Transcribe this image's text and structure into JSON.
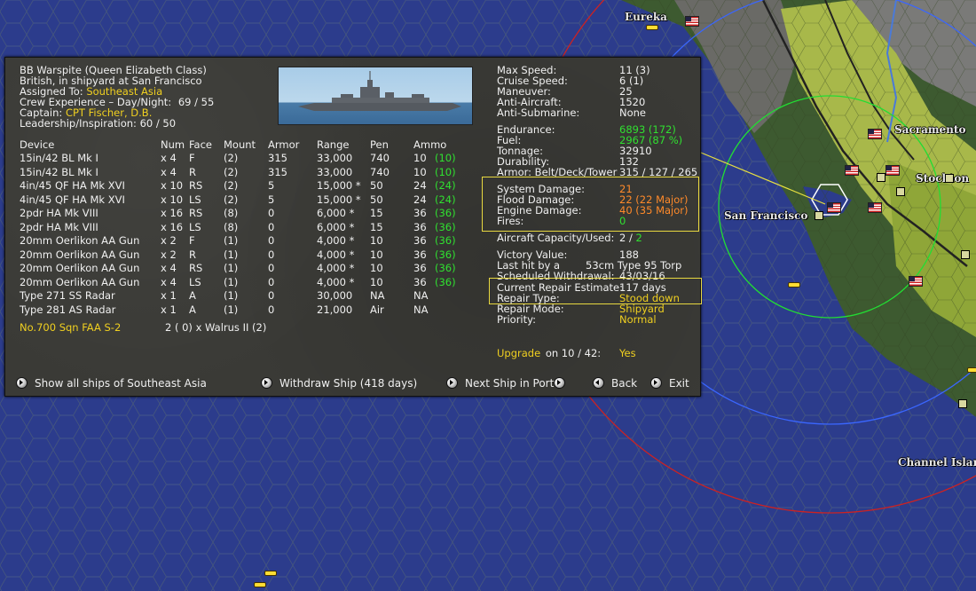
{
  "map": {
    "towns": [
      {
        "name": "Eureka"
      },
      {
        "name": "Sacramento"
      },
      {
        "name": "Stockton"
      },
      {
        "name": "San Francisco"
      },
      {
        "name": "Channel Islan"
      }
    ]
  },
  "ship": {
    "title": "BB Warspite (Queen Elizabeth Class)",
    "location": "British, in shipyard at San Francisco",
    "assigned_label": "Assigned To:",
    "assigned_value": "Southeast Asia",
    "crew_label": "Crew Experience – Day/Night:",
    "crew_value": "69 / 55",
    "captain_label": "Captain:",
    "captain_value": "CPT Fischer, D.B.",
    "leadership_label": "Leadership/Inspiration:",
    "leadership_value": "60 / 50"
  },
  "devices": {
    "headers": [
      "Device",
      "Num",
      "Face",
      "Mount",
      "Armor",
      "Range",
      "Pen",
      "Ammo"
    ],
    "rows": [
      {
        "device": "15in/42 BL Mk I",
        "num": "x 4",
        "face": "F",
        "mount": "(2)",
        "armor": "315",
        "range": "33,000",
        "pen": "740",
        "ammo": "10",
        "ammo2": "(10)"
      },
      {
        "device": "15in/42 BL Mk I",
        "num": "x 4",
        "face": "R",
        "mount": "(2)",
        "armor": "315",
        "range": "33,000",
        "pen": "740",
        "ammo": "10",
        "ammo2": "(10)"
      },
      {
        "device": "4in/45 QF HA Mk XVI",
        "num": "x 10",
        "face": "RS",
        "mount": "(2)",
        "armor": "5",
        "range": "15,000 *",
        "pen": "50",
        "ammo": "24",
        "ammo2": "(24)"
      },
      {
        "device": "4in/45 QF HA Mk XVI",
        "num": "x 10",
        "face": "LS",
        "mount": "(2)",
        "armor": "5",
        "range": "15,000 *",
        "pen": "50",
        "ammo": "24",
        "ammo2": "(24)"
      },
      {
        "device": "2pdr HA Mk VIII",
        "num": "x 16",
        "face": "RS",
        "mount": "(8)",
        "armor": "0",
        "range": "6,000 *",
        "pen": "15",
        "ammo": "36",
        "ammo2": "(36)"
      },
      {
        "device": "2pdr HA Mk VIII",
        "num": "x 16",
        "face": "LS",
        "mount": "(8)",
        "armor": "0",
        "range": "6,000 *",
        "pen": "15",
        "ammo": "36",
        "ammo2": "(36)"
      },
      {
        "device": "20mm Oerlikon AA Gun",
        "num": "x 2",
        "face": "F",
        "mount": "(1)",
        "armor": "0",
        "range": "4,000 *",
        "pen": "10",
        "ammo": "36",
        "ammo2": "(36)"
      },
      {
        "device": "20mm Oerlikon AA Gun",
        "num": "x 2",
        "face": "R",
        "mount": "(1)",
        "armor": "0",
        "range": "4,000 *",
        "pen": "10",
        "ammo": "36",
        "ammo2": "(36)"
      },
      {
        "device": "20mm Oerlikon AA Gun",
        "num": "x 4",
        "face": "RS",
        "mount": "(1)",
        "armor": "0",
        "range": "4,000 *",
        "pen": "10",
        "ammo": "36",
        "ammo2": "(36)"
      },
      {
        "device": "20mm Oerlikon AA Gun",
        "num": "x 4",
        "face": "LS",
        "mount": "(1)",
        "armor": "0",
        "range": "4,000 *",
        "pen": "10",
        "ammo": "36",
        "ammo2": "(36)"
      },
      {
        "device": "Type 271 SS Radar",
        "num": "x 1",
        "face": "A",
        "mount": "(1)",
        "armor": "0",
        "range": "30,000",
        "pen": "NA",
        "ammo": "NA",
        "ammo2": ""
      },
      {
        "device": "Type 281 AS Radar",
        "num": "x 1",
        "face": "A",
        "mount": "(1)",
        "armor": "0",
        "range": "21,000",
        "pen": "Air",
        "ammo": "NA",
        "ammo2": ""
      }
    ]
  },
  "air_group": {
    "name": "No.700 Sqn FAA S-2",
    "value": "2 ( 0) x Walrus II (2)"
  },
  "stats": {
    "max_speed": {
      "label": "Max Speed:",
      "value": "11 (3)"
    },
    "cruise_speed": {
      "label": "Cruise Speed:",
      "value": "6 (1)"
    },
    "maneuver": {
      "label": "Maneuver:",
      "value": "25"
    },
    "anti_aircraft": {
      "label": "Anti-Aircraft:",
      "value": "1520"
    },
    "anti_sub": {
      "label": "Anti-Submarine:",
      "value": "None"
    },
    "endurance": {
      "label": "Endurance:",
      "value": "6893 (172)"
    },
    "fuel": {
      "label": "Fuel:",
      "value": "2967 (87 %)"
    },
    "tonnage": {
      "label": "Tonnage:",
      "value": "32910"
    },
    "durability": {
      "label": "Durability:",
      "value": "132"
    },
    "armor": {
      "label": "Armor: Belt/Deck/Tower",
      "value": "315 / 127 / 265"
    },
    "system_damage": {
      "label": "System Damage:",
      "value": "21"
    },
    "flood_damage": {
      "label": "Flood Damage:",
      "value": "22  (22 Major)"
    },
    "engine_damage": {
      "label": "Engine Damage:",
      "value": "40  (35 Major)"
    },
    "fires": {
      "label": "Fires:",
      "value": "0"
    },
    "aircraft_capacity": {
      "label": "Aircraft Capacity/Used:",
      "value1": "2 /",
      "value2": "2"
    },
    "victory_value": {
      "label": "Victory Value:",
      "value": "188"
    },
    "last_hit": {
      "label": "Last hit by a",
      "value": "53cm Type 95 Torp"
    },
    "withdrawal": {
      "label": "Scheduled Withdrawal:",
      "value": "43/03/16"
    },
    "repair_estimate": {
      "label": "Current Repair Estimate:",
      "value": "117 days"
    },
    "repair_type": {
      "label": "Repair Type:",
      "value": "Stood down"
    },
    "repair_mode": {
      "label": "Repair Mode:",
      "value": "Shipyard"
    },
    "priority": {
      "label": "Priority:",
      "value": "Normal"
    },
    "upgrade": {
      "label": "Upgrade",
      "on": "on  10 / 42:",
      "value": "Yes"
    }
  },
  "buttons": {
    "show_all": "Show all ships of Southeast Asia",
    "withdraw": "Withdraw Ship (418 days)",
    "next_ship": "Next Ship in Port",
    "back": "Back",
    "exit": "Exit"
  }
}
